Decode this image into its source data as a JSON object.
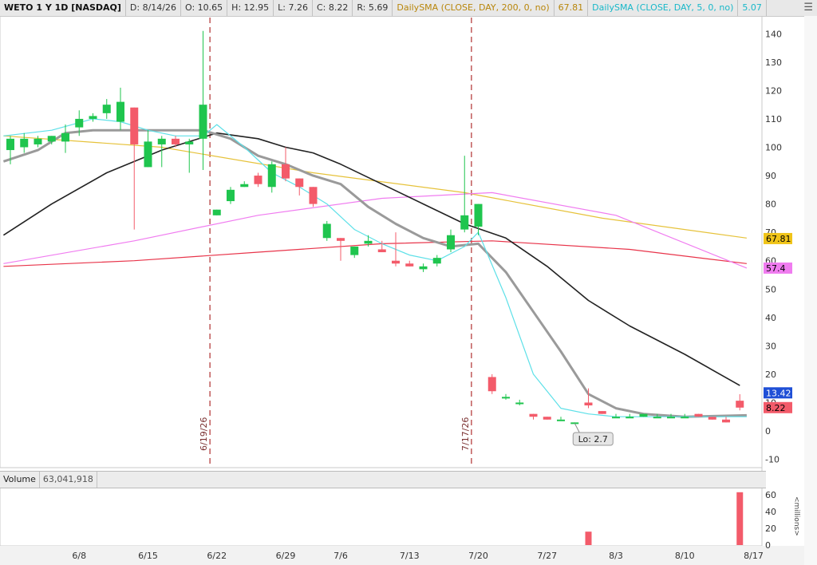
{
  "header": {
    "symbol": "WETO 1 Y 1D [NASDAQ]",
    "date": "D: 8/14/26",
    "open": "O: 10.65",
    "high": "H: 12.95",
    "low": "L: 7.26",
    "close": "C: 8.22",
    "range": "R: 5.69",
    "sma200_label": "DailySMA (CLOSE, DAY, 200, 0, no)",
    "sma200_value": "67.81",
    "sma5_label": "DailySMA (CLOSE, DAY, 5, 0, no)",
    "sma5_value": "5.07"
  },
  "volume_panel": {
    "label": "Volume",
    "value": "63,041,918",
    "units": "<millions>"
  },
  "colors": {
    "up": "#1fc54e",
    "down": "#f35b6a",
    "sma200": "#e6c23a",
    "red_ma": "#e8344a",
    "pink_ma": "#f07cf0",
    "black_ma": "#222222",
    "gray_ma": "#9a9a9a",
    "cyan_ma": "#5de0e8",
    "vline": "#b03030"
  },
  "chart_data": {
    "type": "candlestick",
    "x_axis_labels": [
      {
        "label": "6/8",
        "i": 5
      },
      {
        "label": "6/15",
        "i": 10
      },
      {
        "label": "6/22",
        "i": 15
      },
      {
        "label": "6/29",
        "i": 20
      },
      {
        "label": "7/6",
        "i": 24
      },
      {
        "label": "7/13",
        "i": 29
      },
      {
        "label": "7/20",
        "i": 34
      },
      {
        "label": "7/27",
        "i": 39
      },
      {
        "label": "8/3",
        "i": 44
      },
      {
        "label": "8/10",
        "i": 49
      },
      {
        "label": "8/17",
        "i": 54
      }
    ],
    "y_ticks": [
      -10,
      0,
      10,
      20,
      30,
      40,
      50,
      60,
      70,
      80,
      90,
      100,
      110,
      120,
      130,
      140
    ],
    "ylim": [
      -10,
      150
    ],
    "vertical_markers": [
      {
        "label": "6/19/26",
        "i": 14
      },
      {
        "label": "7/17/26",
        "i": 33
      }
    ],
    "candles": [
      {
        "i": 0,
        "o": 99,
        "h": 104,
        "l": 94,
        "c": 103
      },
      {
        "i": 1,
        "o": 100,
        "h": 105,
        "l": 98,
        "c": 103
      },
      {
        "i": 2,
        "o": 101,
        "h": 104,
        "l": 100,
        "c": 103
      },
      {
        "i": 3,
        "o": 102,
        "h": 104,
        "l": 101,
        "c": 104
      },
      {
        "i": 4,
        "o": 102,
        "h": 108,
        "l": 98,
        "c": 105
      },
      {
        "i": 5,
        "o": 107,
        "h": 113,
        "l": 104,
        "c": 110
      },
      {
        "i": 6,
        "o": 110,
        "h": 112,
        "l": 109,
        "c": 111
      },
      {
        "i": 7,
        "o": 112,
        "h": 117,
        "l": 110,
        "c": 115
      },
      {
        "i": 8,
        "o": 109,
        "h": 121,
        "l": 106,
        "c": 116
      },
      {
        "i": 9,
        "o": 114,
        "h": 114,
        "l": 71,
        "c": 101
      },
      {
        "i": 10,
        "o": 93,
        "h": 106,
        "l": 93,
        "c": 102
      },
      {
        "i": 11,
        "o": 101,
        "h": 104,
        "l": 93,
        "c": 103
      },
      {
        "i": 12,
        "o": 103,
        "h": 104,
        "l": 100,
        "c": 101
      },
      {
        "i": 13,
        "o": 101,
        "h": 103,
        "l": 91,
        "c": 102
      },
      {
        "i": 14,
        "o": 103,
        "h": 141,
        "l": 92,
        "c": 115
      },
      {
        "i": 15,
        "o": 76,
        "h": 78,
        "l": 76,
        "c": 78
      },
      {
        "i": 16,
        "o": 81,
        "h": 86,
        "l": 80,
        "c": 85
      },
      {
        "i": 17,
        "o": 86,
        "h": 88,
        "l": 86,
        "c": 87
      },
      {
        "i": 18,
        "o": 90,
        "h": 91,
        "l": 86,
        "c": 87
      },
      {
        "i": 19,
        "o": 86,
        "h": 95,
        "l": 84,
        "c": 94
      },
      {
        "i": 20,
        "o": 94,
        "h": 100,
        "l": 88,
        "c": 89
      },
      {
        "i": 21,
        "o": 89,
        "h": 89,
        "l": 83,
        "c": 86
      },
      {
        "i": 22,
        "o": 86,
        "h": 86,
        "l": 79,
        "c": 80
      },
      {
        "i": 23,
        "o": 68,
        "h": 74,
        "l": 67,
        "c": 73
      },
      {
        "i": 24,
        "o": 68,
        "h": 68,
        "l": 60,
        "c": 67
      },
      {
        "i": 25,
        "o": 62,
        "h": 65,
        "l": 61,
        "c": 65
      },
      {
        "i": 26,
        "o": 66,
        "h": 69,
        "l": 65,
        "c": 67
      },
      {
        "i": 27,
        "o": 64,
        "h": 67,
        "l": 63,
        "c": 63
      },
      {
        "i": 28,
        "o": 60,
        "h": 70,
        "l": 58,
        "c": 59
      },
      {
        "i": 29,
        "o": 59,
        "h": 60,
        "l": 58,
        "c": 58
      },
      {
        "i": 30,
        "o": 57,
        "h": 59,
        "l": 56,
        "c": 58
      },
      {
        "i": 31,
        "o": 59,
        "h": 62,
        "l": 58,
        "c": 61
      },
      {
        "i": 32,
        "o": 64,
        "h": 71,
        "l": 63,
        "c": 69
      },
      {
        "i": 33,
        "o": 71,
        "h": 97,
        "l": 70,
        "c": 76
      },
      {
        "i": 34,
        "o": 72,
        "h": 80,
        "l": 69,
        "c": 80
      },
      {
        "i": 35,
        "o": 19,
        "h": 20,
        "l": 13,
        "c": 14
      },
      {
        "i": 36,
        "o": 12,
        "h": 13,
        "l": 11,
        "c": 12
      },
      {
        "i": 37,
        "o": 10,
        "h": 11,
        "l": 9,
        "c": 10
      },
      {
        "i": 38,
        "o": 6,
        "h": 6,
        "l": 4,
        "c": 5
      },
      {
        "i": 39,
        "o": 5,
        "h": 5,
        "l": 4,
        "c": 4
      },
      {
        "i": 40,
        "o": 4,
        "h": 5,
        "l": 4,
        "c": 4
      },
      {
        "i": 41,
        "o": 3,
        "h": 3,
        "l": 2.7,
        "c": 3
      },
      {
        "i": 42,
        "o": 10,
        "h": 15,
        "l": 8,
        "c": 9
      },
      {
        "i": 43,
        "o": 7,
        "h": 7,
        "l": 6,
        "c": 6
      },
      {
        "i": 44,
        "o": 5,
        "h": 6,
        "l": 5,
        "c": 5
      },
      {
        "i": 45,
        "o": 5,
        "h": 6,
        "l": 5,
        "c": 5
      },
      {
        "i": 46,
        "o": 5,
        "h": 6,
        "l": 5,
        "c": 6
      },
      {
        "i": 47,
        "o": 5,
        "h": 6,
        "l": 5,
        "c": 5
      },
      {
        "i": 48,
        "o": 5,
        "h": 6,
        "l": 5,
        "c": 5
      },
      {
        "i": 49,
        "o": 5,
        "h": 6,
        "l": 5,
        "c": 5
      },
      {
        "i": 50,
        "o": 6,
        "h": 6,
        "l": 5,
        "c": 5
      },
      {
        "i": 51,
        "o": 5,
        "h": 5,
        "l": 4,
        "c": 4
      },
      {
        "i": 52,
        "o": 4,
        "h": 5,
        "l": 3,
        "c": 3
      },
      {
        "i": 53,
        "o": 10.65,
        "h": 12.95,
        "l": 7.26,
        "c": 8.22
      }
    ],
    "series": [
      {
        "key": "sma200",
        "points": [
          [
            -0.5,
            104
          ],
          [
            11,
            100
          ],
          [
            22,
            91
          ],
          [
            33,
            84
          ],
          [
            43,
            75
          ],
          [
            53.5,
            68
          ]
        ]
      },
      {
        "key": "red_ma",
        "points": [
          [
            -0.5,
            58
          ],
          [
            9,
            60
          ],
          [
            18,
            63
          ],
          [
            27,
            66
          ],
          [
            35,
            67
          ],
          [
            45,
            64
          ],
          [
            53.5,
            59
          ]
        ]
      },
      {
        "key": "pink_ma",
        "points": [
          [
            -0.5,
            59
          ],
          [
            9,
            67
          ],
          [
            18,
            76
          ],
          [
            27,
            82
          ],
          [
            35,
            84
          ],
          [
            44,
            76
          ],
          [
            53.5,
            57.4
          ]
        ]
      },
      {
        "key": "black_ma",
        "points": [
          [
            -0.5,
            69
          ],
          [
            3,
            80
          ],
          [
            7,
            91
          ],
          [
            11,
            99
          ],
          [
            15,
            105
          ],
          [
            18,
            103
          ],
          [
            20,
            100
          ],
          [
            22,
            98
          ],
          [
            24,
            94
          ],
          [
            27,
            87
          ],
          [
            30,
            80
          ],
          [
            33,
            73
          ],
          [
            36,
            68
          ],
          [
            39,
            58
          ],
          [
            42,
            46
          ],
          [
            45,
            37
          ],
          [
            49,
            27
          ],
          [
            53,
            16
          ]
        ]
      },
      {
        "key": "gray_ma",
        "points": [
          [
            -0.5,
            95
          ],
          [
            2,
            99
          ],
          [
            4,
            105
          ],
          [
            6,
            106
          ],
          [
            8,
            106
          ],
          [
            10,
            106
          ],
          [
            12,
            106
          ],
          [
            14,
            106
          ],
          [
            16,
            103
          ],
          [
            18,
            97
          ],
          [
            20,
            94
          ],
          [
            22,
            90
          ],
          [
            24,
            87
          ],
          [
            26,
            79
          ],
          [
            28,
            73
          ],
          [
            30,
            68
          ],
          [
            32,
            65
          ],
          [
            34,
            66
          ],
          [
            36,
            56
          ],
          [
            38,
            42
          ],
          [
            40,
            28
          ],
          [
            42,
            13
          ],
          [
            44,
            8
          ],
          [
            46,
            6
          ],
          [
            49,
            5
          ],
          [
            53.5,
            5.5
          ]
        ]
      },
      {
        "key": "cyan_ma",
        "points": [
          [
            -0.5,
            104
          ],
          [
            3,
            106
          ],
          [
            6,
            110
          ],
          [
            8,
            109
          ],
          [
            10,
            106
          ],
          [
            12,
            104
          ],
          [
            14,
            104
          ],
          [
            15,
            108
          ],
          [
            17,
            100
          ],
          [
            19,
            91
          ],
          [
            21,
            86
          ],
          [
            23,
            80
          ],
          [
            25,
            71
          ],
          [
            27,
            66
          ],
          [
            29,
            62
          ],
          [
            31,
            60
          ],
          [
            33,
            65
          ],
          [
            34,
            70
          ],
          [
            36,
            47
          ],
          [
            38,
            20
          ],
          [
            40,
            8
          ],
          [
            42,
            6
          ],
          [
            44,
            5
          ],
          [
            47,
            5
          ],
          [
            50,
            5
          ],
          [
            53.5,
            5
          ]
        ]
      }
    ],
    "price_labels": [
      {
        "text": "67.81",
        "value": 67.81,
        "bg": "#f0c419",
        "fg": "#000000"
      },
      {
        "text": "57.4",
        "value": 57.4,
        "bg": "#f07cf0",
        "fg": "#000000"
      },
      {
        "text": "13.42",
        "value": 13.42,
        "bg": "#1f4fd6",
        "fg": "#ffffff"
      },
      {
        "text": "8.22",
        "value": 8.22,
        "bg": "#f35b6a",
        "fg": "#000000"
      }
    ],
    "annotation": {
      "text": "Lo: 2.7",
      "i": 41,
      "value": 2.7
    },
    "volume": {
      "ylim": [
        0,
        65
      ],
      "y_ticks": [
        0,
        20,
        40,
        60
      ],
      "bars": [
        {
          "i": 42,
          "value": 16
        },
        {
          "i": 53,
          "value": 63.04
        }
      ]
    }
  }
}
